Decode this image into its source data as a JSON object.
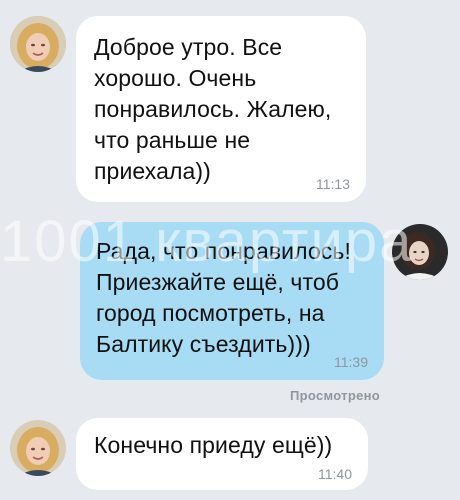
{
  "chat": {
    "messages": [
      {
        "direction": "incoming",
        "text": "Доброе утро. Все\nхорошо. Очень\nпонравилось. Жалею,\nчто раньше не\nприехала))",
        "time": "11:13",
        "avatar_icon": "user-photo-blonde-woman"
      },
      {
        "direction": "outgoing",
        "text": "Рада, что понравилось!\nПриезжайте ещё, чтоб\nгород посмотреть, на\nБалтику съездить)))",
        "time": "11:39",
        "avatar_icon": "user-photo-woman-dark"
      },
      {
        "direction": "incoming",
        "text": "Конечно приеду ещё))",
        "time": "11:40",
        "avatar_icon": "user-photo-blonde-woman"
      }
    ],
    "read_receipt": "Просмотрено",
    "watermark": "1001 квартира"
  },
  "colors": {
    "background": "#e6e9ee",
    "incoming_bubble": "#ffffff",
    "outgoing_bubble": "#a7dcf4",
    "timestamp": "#8f969d"
  }
}
